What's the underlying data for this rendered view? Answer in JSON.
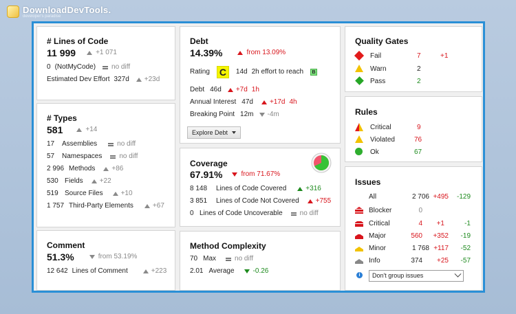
{
  "watermark": {
    "name": "DownloadDevTools.",
    "tagline": "developer's paradise"
  },
  "loc": {
    "title": "# Lines of Code",
    "value": "11 999",
    "delta": "+1 071",
    "notmycode_value": "0",
    "notmycode_label": "(NotMyCode)",
    "notmycode_delta": "no diff",
    "effort_label": "Estimated Dev Effort",
    "effort_value": "327d",
    "effort_delta": "+23d"
  },
  "types": {
    "title": "# Types",
    "value": "581",
    "delta": "+14",
    "rows": [
      {
        "value": "17",
        "label": "Assemblies",
        "delta": "no diff"
      },
      {
        "value": "57",
        "label": "Namespaces",
        "delta": "no diff"
      },
      {
        "value": "2 996",
        "label": "Methods",
        "delta": "+86"
      },
      {
        "value": "530",
        "label": "Fields",
        "delta": "+22"
      },
      {
        "value": "519",
        "label": "Source Files",
        "delta": "+10"
      },
      {
        "value": "1 757",
        "label": "Third-Party Elements",
        "delta": "+67"
      }
    ]
  },
  "comment": {
    "title": "Comment",
    "value": "51.3%",
    "from": "from 53.19%",
    "lines_value": "12 642",
    "lines_label": "Lines of Comment",
    "lines_delta": "+223"
  },
  "debt": {
    "title": "Debt",
    "value": "14.39%",
    "from": "from 13.09%",
    "rating_label": "Rating",
    "rating": "C",
    "effort": "14d",
    "effort_text": "2h effort to reach",
    "target": "B",
    "debt_label": "Debt",
    "debt_value": "46d",
    "debt_delta_d": "+7d",
    "debt_delta_h": "1h",
    "interest_label": "Annual Interest",
    "interest_value": "47d",
    "interest_delta_d": "+17d",
    "interest_delta_h": "4h",
    "bp_label": "Breaking Point",
    "bp_value": "12m",
    "bp_delta": "-4m",
    "explore_label": "Explore Debt"
  },
  "coverage": {
    "title": "Coverage",
    "value": "67.91%",
    "from": "from 71.67%",
    "covered_fraction": 0.6791,
    "rows": [
      {
        "value": "8 148",
        "label": "Lines of Code Covered",
        "delta": "+316"
      },
      {
        "value": "3 851",
        "label": "Lines of Code Not Covered",
        "delta": "+755"
      },
      {
        "value": "0",
        "label": "Lines of Code Uncoverable",
        "delta": "no diff"
      }
    ]
  },
  "complexity": {
    "title": "Method Complexity",
    "max_value": "70",
    "max_label": "Max",
    "max_delta": "no diff",
    "avg_value": "2.01",
    "avg_label": "Average",
    "avg_delta": "-0.26"
  },
  "quality_gates": {
    "title": "Quality Gates",
    "rows": [
      {
        "label": "Fail",
        "count": "7",
        "delta": "+1"
      },
      {
        "label": "Warn",
        "count": "2",
        "delta": ""
      },
      {
        "label": "Pass",
        "count": "2",
        "delta": ""
      }
    ]
  },
  "rules": {
    "title": "Rules",
    "rows": [
      {
        "label": "Critical",
        "count": "9"
      },
      {
        "label": "Violated",
        "count": "76"
      },
      {
        "label": "Ok",
        "count": "67"
      }
    ]
  },
  "issues": {
    "title": "Issues",
    "rows": [
      {
        "label": "All",
        "count": "2 706",
        "added": "+495",
        "removed": "-129"
      },
      {
        "label": "Blocker",
        "count": "0",
        "added": "",
        "removed": ""
      },
      {
        "label": "Critical",
        "count": "4",
        "added": "+1",
        "removed": "-1"
      },
      {
        "label": "Major",
        "count": "560",
        "added": "+352",
        "removed": "-19"
      },
      {
        "label": "Minor",
        "count": "1 768",
        "added": "+117",
        "removed": "-52"
      },
      {
        "label": "Info",
        "count": "374",
        "added": "+25",
        "removed": "-57"
      }
    ],
    "group_select": "Don't group issues"
  },
  "colors": {
    "accent_frame": "#2a8fd6",
    "red": "#d8151c",
    "green": "#1d8a1d",
    "rating_c": "#f5f500",
    "rating_b": "#7ee07e"
  }
}
